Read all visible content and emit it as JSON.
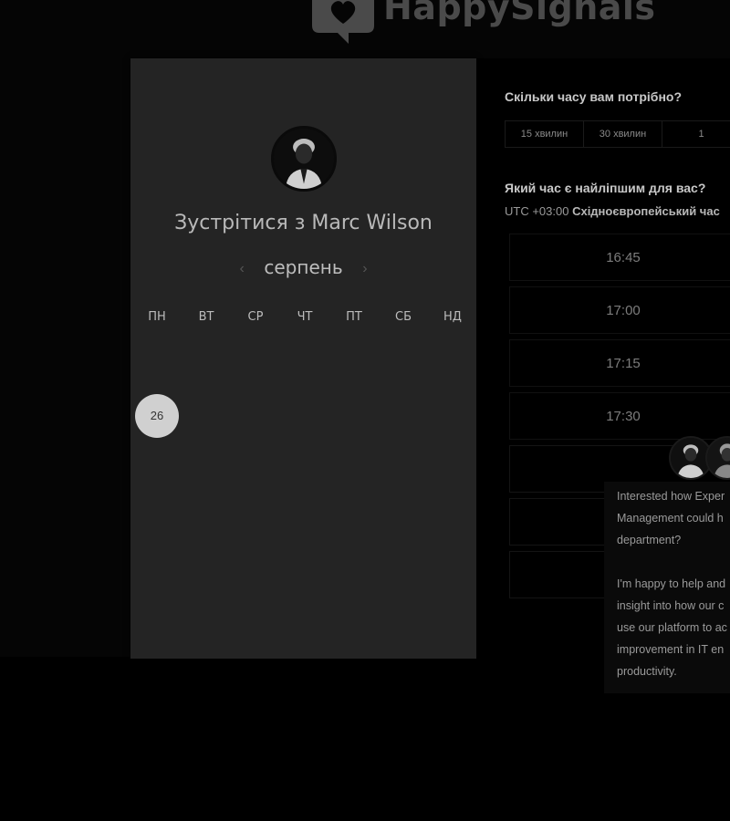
{
  "brand": {
    "name": "HappySignals",
    "icon": "speech-bubble-heart-icon"
  },
  "host": {
    "title": "Зустрітися з Marc Wilson",
    "avatar_icon": "person-avatar-icon"
  },
  "calendar": {
    "month": "серпень",
    "prev_icon": "‹",
    "next_icon": "›",
    "weekdays": [
      "ПН",
      "ВТ",
      "СР",
      "ЧТ",
      "ПТ",
      "СБ",
      "НД"
    ],
    "selected_day": "26"
  },
  "duration": {
    "question": "Скільки часу вам потрібно?",
    "options": [
      "15 хвилин",
      "30 хвилин",
      "1"
    ]
  },
  "time": {
    "question": "Який час є найліпшим для вас?",
    "tz_offset": "UTC +03:00",
    "tz_name": "Східноєвропейський час",
    "slots": [
      "16:45",
      "17:00",
      "17:15",
      "17:30"
    ]
  },
  "chat": {
    "lines": [
      "Interested how Exper",
      "Management could h",
      "department?",
      "",
      "I'm happy to help and",
      "insight into how our c",
      "use our platform to ac",
      "improvement in IT en",
      "productivity."
    ]
  },
  "colors": {
    "background": "#000000",
    "panel": "#242424",
    "selected_day": "#d0d0d0"
  }
}
